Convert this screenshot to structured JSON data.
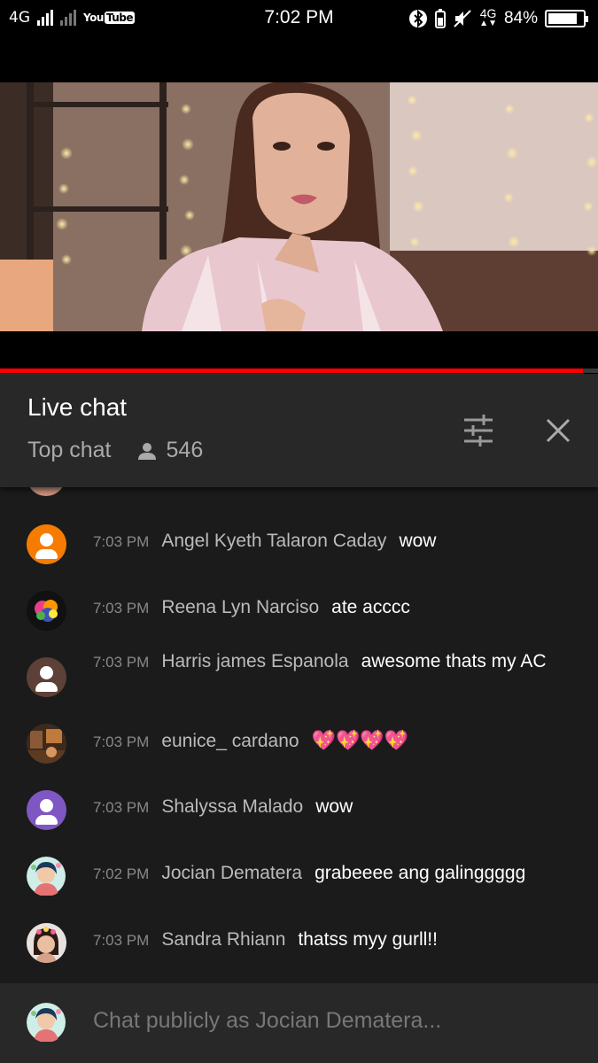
{
  "status_bar": {
    "network_left": "4G",
    "app_logo_you": "You",
    "app_logo_tube": "Tube",
    "time": "7:02 PM",
    "network_right": "4G",
    "battery": "84%"
  },
  "video": {
    "progress": 0.975,
    "accent": "#ff0000"
  },
  "chat": {
    "title": "Live chat",
    "mode": "Top chat",
    "viewers": "546",
    "messages": [
      {
        "time": "7:03 PM",
        "author": "Angel Kyeth Talaron Caday",
        "text": "wow",
        "avatar": "default-avatar-orange",
        "avatar_color": "#f57c00"
      },
      {
        "time": "7:03 PM",
        "author": "Reena Lyn Narciso",
        "text": "ate acccc",
        "avatar": "colorful-photo-avatar"
      },
      {
        "time": "7:03 PM",
        "author": "Harris james Espanola",
        "text": "awesome thats my AC",
        "avatar": "default-avatar-brown",
        "avatar_color": "#5d4037"
      },
      {
        "time": "7:03 PM",
        "author": "eunice_ cardano",
        "text": "💖💖💖💖",
        "avatar": "photo-avatar"
      },
      {
        "time": "7:03 PM",
        "author": "Shalyssa Malado",
        "text": "wow",
        "avatar": "default-avatar-purple",
        "avatar_color": "#7e57c2"
      },
      {
        "time": "7:02 PM",
        "author": "Jocian Dematera",
        "text": "grabeeee ang galinggggg",
        "avatar": "cartoon-avatar"
      },
      {
        "time": "7:03 PM",
        "author": "Sandra Rhiann",
        "text": "thatss myy gurll!!",
        "avatar": "photo-avatar"
      }
    ],
    "input_placeholder": "Chat publicly as Jocian Dematera..."
  }
}
